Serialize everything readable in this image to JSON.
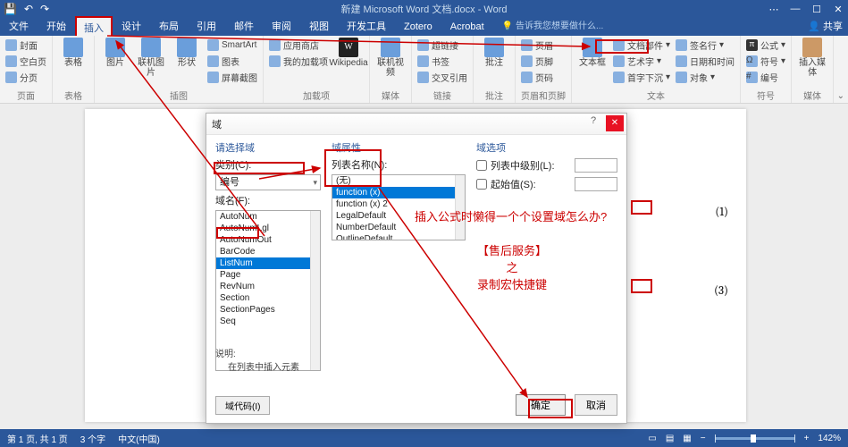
{
  "titlebar": {
    "doc_title": "新建 Microsoft Word 文档.docx - Word"
  },
  "tell_me": "告诉我您想要做什么...",
  "share": "共享",
  "tabs": [
    "文件",
    "开始",
    "插入",
    "设计",
    "布局",
    "引用",
    "邮件",
    "审阅",
    "视图",
    "开发工具",
    "Zotero",
    "Acrobat"
  ],
  "ribbon": {
    "g1": {
      "cover": "封面",
      "blank": "空白页",
      "pagebreak": "分页",
      "label": "页面"
    },
    "g2": {
      "table": "表格",
      "label": "表格"
    },
    "g3": {
      "pic": "图片",
      "online": "联机图片",
      "shape": "形状",
      "smartart": "SmartArt",
      "chart": "图表",
      "screenshot": "屏幕截图",
      "label": "插图"
    },
    "g4": {
      "store": "应用商店",
      "myaddin": "我的加载项",
      "wiki": "Wikipedia",
      "label": "加载项"
    },
    "g5": {
      "video": "联机视频",
      "label": "媒体"
    },
    "g6": {
      "link": "超链接",
      "bookmark": "书签",
      "xref": "交叉引用",
      "label": "链接"
    },
    "g7": {
      "comment": "批注",
      "label": "批注"
    },
    "g8": {
      "header": "页眉",
      "footer": "页脚",
      "pagenum": "页码",
      "label": "页眉和页脚"
    },
    "g9": {
      "textbox": "文本框",
      "quickparts": "文档部件",
      "wordart": "艺术字",
      "dropcap": "首字下沉",
      "sigline": "签名行",
      "datetime": "日期和时间",
      "object": "对象",
      "label": "文本"
    },
    "g10": {
      "equation": "公式",
      "symbol": "符号",
      "number": "编号",
      "label": "符号"
    },
    "g11": {
      "media": "插入媒体",
      "label": "媒体"
    }
  },
  "dialog": {
    "title": "域",
    "choose_field": "请选择域",
    "category_lbl": "类别(C):",
    "category_val": "编号",
    "fieldname_lbl": "域名(F):",
    "fields": [
      "AutoNum",
      "AutoNumLgl",
      "AutoNumOut",
      "BarCode",
      "ListNum",
      "Page",
      "RevNum",
      "Section",
      "SectionPages",
      "Seq"
    ],
    "selected_field": "ListNum",
    "props_hdr": "域属性",
    "listname_lbl": "列表名称(N):",
    "listnames": [
      "(无)",
      "function (x)",
      "function (x) 2",
      "LegalDefault",
      "NumberDefault",
      "OutlineDefault"
    ],
    "selected_listname": "function (x)",
    "options_hdr": "域选项",
    "opt_level": "列表中级别(L):",
    "opt_start": "起始值(S):",
    "desc_lbl": "说明:",
    "desc_txt": "在列表中插入元素",
    "code_btn": "域代码(I)",
    "ok": "确定",
    "cancel": "取消"
  },
  "doc": {
    "eq1": "(1)",
    "eq2": "(3)"
  },
  "anno": {
    "q": "插入公式时懒得一个个设置域怎么办?",
    "t1": "【售后服务】",
    "t2": "之",
    "t3": "录制宏快捷键"
  },
  "status": {
    "page": "第 1 页, 共 1 页",
    "words": "3 个字",
    "lang": "中文(中国)",
    "zoom": "142%"
  }
}
